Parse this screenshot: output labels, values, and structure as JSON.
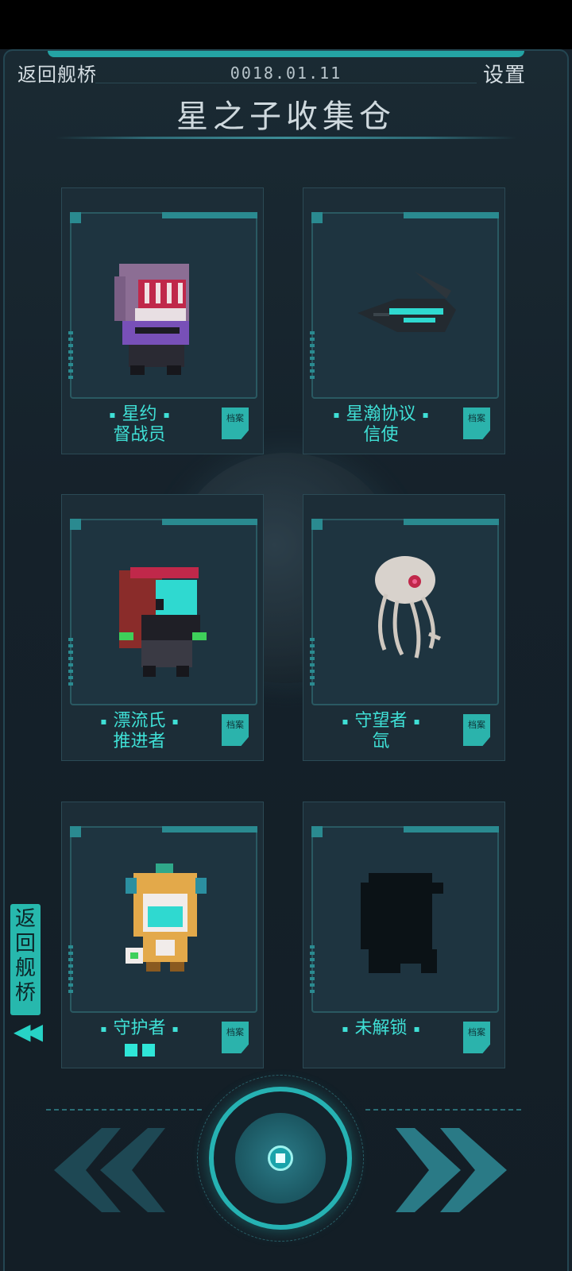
{
  "header": {
    "back_label": "返回舰桥",
    "date": "0018.01.11",
    "settings_label": "设置",
    "title": "星之子收集仓"
  },
  "cards": [
    {
      "line1": "星约",
      "line2": "督战员",
      "archive": "档案",
      "pips": 0
    },
    {
      "line1": "星瀚协议",
      "line2": "信使",
      "archive": "档案",
      "pips": 0
    },
    {
      "line1": "漂流氏",
      "line2": "推进者",
      "archive": "档案",
      "pips": 0
    },
    {
      "line1": "守望者",
      "line2": "氙",
      "archive": "档案",
      "pips": 0
    },
    {
      "line1": "守护者",
      "line2": "",
      "archive": "档案",
      "pips": 2
    },
    {
      "line1": "未解锁",
      "line2": "",
      "archive": "档案",
      "pips": 0
    }
  ],
  "side_back_label": "返回舰桥",
  "colors": {
    "accent": "#2fe6d8",
    "card_border": "#2b4a55",
    "background": "#16222b"
  },
  "icons": [
    "chevron-left-double-icon",
    "chevron-right-double-icon",
    "archive-icon"
  ]
}
